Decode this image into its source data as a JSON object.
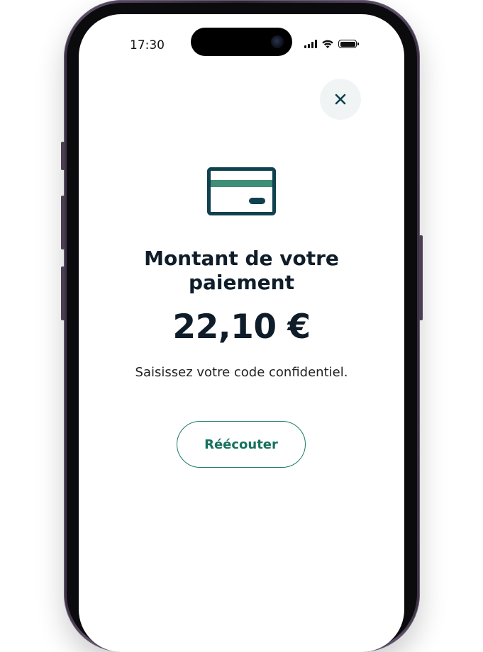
{
  "status_bar": {
    "time": "17:30",
    "icons": [
      "cellular-signal-icon",
      "wifi-icon",
      "battery-icon"
    ]
  },
  "dialog": {
    "close_icon": "close-icon",
    "illustration_icon": "credit-card-icon",
    "title": "Montant de votre paiement",
    "amount": "22,10 €",
    "instruction": "Saisissez votre code confidentiel.",
    "replay_label": "Réécouter"
  },
  "colors": {
    "primary_dark": "#0f1d2a",
    "card_dark": "#10414f",
    "card_stripe": "#3f8e77",
    "accent_green": "#17715f",
    "close_button_bg": "#f1f4f5",
    "phone_frame": "#3b3142"
  }
}
